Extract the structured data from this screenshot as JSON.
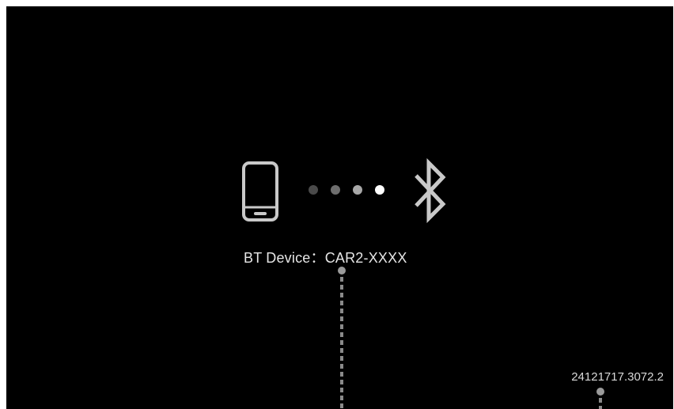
{
  "device": {
    "prefix": "BT Device：",
    "name": "CAR2-XXXX"
  },
  "connection_progress": {
    "dots_total": 4,
    "dots_active": 1,
    "active_color": "#ffffff",
    "inactive_colors": [
      "#4a4a4a",
      "#6e6e6e",
      "#a8a8a8"
    ]
  },
  "version": "24121717.3072.2",
  "colors": {
    "background": "#000000",
    "icon": "#c9c9c9",
    "text": "#e6e6e6"
  },
  "icons": {
    "phone": "smartphone-icon",
    "bluetooth": "bluetooth-icon"
  }
}
